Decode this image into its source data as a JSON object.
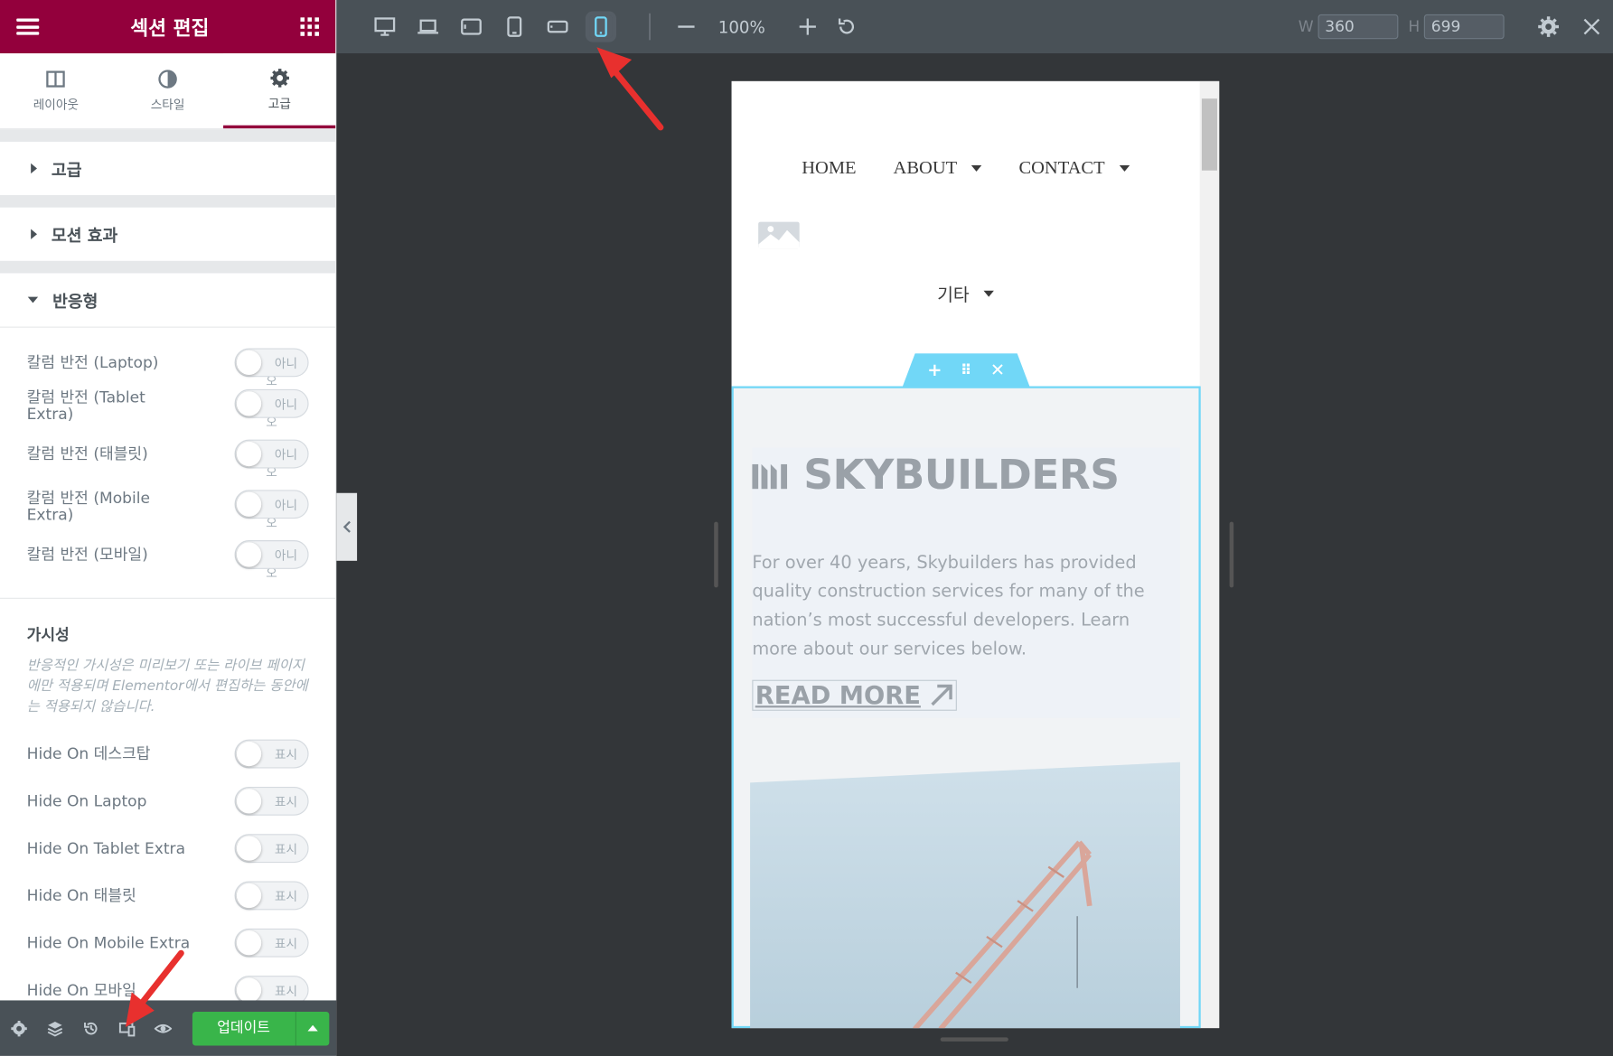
{
  "sidebar": {
    "title": "섹션 편집",
    "tabs": [
      {
        "label": "레이아웃",
        "icon": "layout-icon"
      },
      {
        "label": "스타일",
        "icon": "contrast-icon"
      },
      {
        "label": "고급",
        "icon": "gear-icon",
        "active": true
      }
    ],
    "sections": {
      "advanced": "고급",
      "motion": "모션 효과",
      "responsive": "반응형"
    },
    "reverse_columns": [
      {
        "label": "칼럼 반전 (Laptop)",
        "toggle": "아니",
        "sub": "오"
      },
      {
        "label": "칼럼 반전 (Tablet Extra)",
        "toggle": "아니",
        "sub": "오"
      },
      {
        "label": "칼럼 반전 (태블릿)",
        "toggle": "아니",
        "sub": "오"
      },
      {
        "label": "칼럼 반전 (Mobile Extra)",
        "toggle": "아니",
        "sub": "오"
      },
      {
        "label": "칼럼 반전 (모바일)",
        "toggle": "아니",
        "sub": "오"
      }
    ],
    "visibility_title": "가시성",
    "visibility_desc": "반응적인 가시성은 미리보기 또는 라이브 페이지에만 적용되며 Elementor에서 편집하는 동안에는 적용되지 않습니다.",
    "hide_on": [
      {
        "label": "Hide On 데스크탑",
        "toggle": "표시"
      },
      {
        "label": "Hide On Laptop",
        "toggle": "표시"
      },
      {
        "label": "Hide On Tablet Extra",
        "toggle": "표시"
      },
      {
        "label": "Hide On 태블릿",
        "toggle": "표시"
      },
      {
        "label": "Hide On Mobile Extra",
        "toggle": "표시"
      },
      {
        "label": "Hide On 모바일",
        "toggle": "표시"
      }
    ],
    "footer": {
      "update_label": "업데이트"
    }
  },
  "topbar": {
    "zoom": "100%",
    "width_label": "W",
    "width_value": "360",
    "height_label": "H",
    "height_value": "699"
  },
  "preview": {
    "nav": [
      {
        "label": "HOME",
        "dropdown": false
      },
      {
        "label": "ABOUT",
        "dropdown": true
      },
      {
        "label": "CONTACT",
        "dropdown": true
      }
    ],
    "other_menu": "기타",
    "logo_text": "SKYBUILDERS",
    "hero_text": "For over 40 years, Skybuilders has provided quality construction services for many of the nation’s most successful developers. Learn more about our services below.",
    "read_more": "READ MORE"
  },
  "colors": {
    "brand": "#93003c",
    "accent": "#71d7f7",
    "update": "#39b54a",
    "toolbar": "#495157"
  }
}
